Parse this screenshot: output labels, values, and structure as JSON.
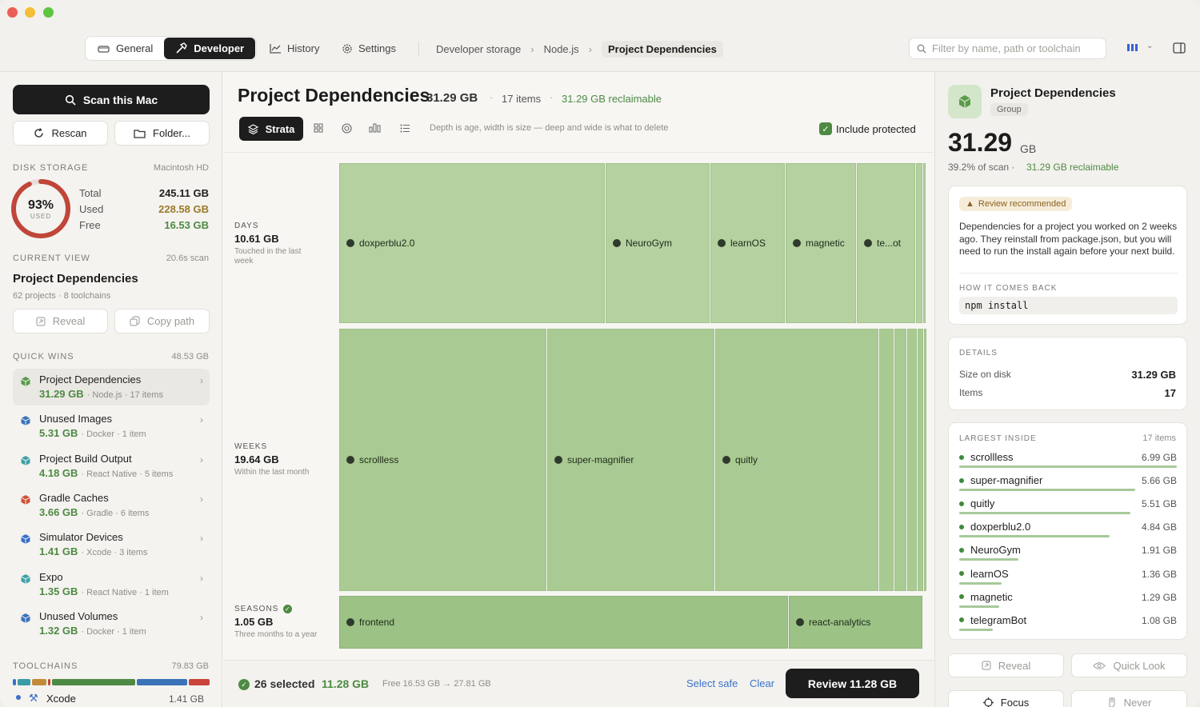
{
  "titlebar": {
    "segments": [
      {
        "label": "General"
      },
      {
        "label": "Developer"
      }
    ],
    "nav": [
      {
        "label": "History"
      },
      {
        "label": "Settings"
      }
    ],
    "breadcrumb": [
      "Developer storage",
      "Node.js",
      "Project Dependencies"
    ],
    "search_placeholder": "Filter by name, path or toolchain"
  },
  "sidebar": {
    "scan_label": "Scan this Mac",
    "rescan_label": "Rescan",
    "folder_label": "Folder...",
    "disk": {
      "section": "DISK STORAGE",
      "volume": "Macintosh HD",
      "percent": "93%",
      "percent_value": 93,
      "used_caption": "USED",
      "rows": [
        {
          "label": "Total",
          "value": "245.11 GB"
        },
        {
          "label": "Used",
          "value": "228.58 GB"
        },
        {
          "label": "Free",
          "value": "16.53 GB"
        }
      ]
    },
    "current_view": {
      "section": "CURRENT VIEW",
      "scan_time": "20.6s scan",
      "title": "Project Dependencies",
      "sub": "62 projects · 8 toolchains",
      "reveal": "Reveal",
      "copy_path": "Copy path"
    },
    "quick_wins": {
      "section": "QUICK WINS",
      "total": "48.53 GB",
      "items": [
        {
          "title": "Project Dependencies",
          "size": "31.29 GB",
          "meta": "· Node.js · 17 items",
          "icon": "cube-green-icon",
          "color": "#5a9a4c"
        },
        {
          "title": "Unused Images",
          "size": "5.31 GB",
          "meta": "· Docker · 1 item",
          "icon": "cube-blue-icon",
          "color": "#3b73b9"
        },
        {
          "title": "Project Build Output",
          "size": "4.18 GB",
          "meta": "· React Native · 5 items",
          "icon": "atom-icon",
          "color": "#3fa0a8"
        },
        {
          "title": "Gradle Caches",
          "size": "3.66 GB",
          "meta": "· Gradle · 6 items",
          "icon": "gears-icon",
          "color": "#d0533b"
        },
        {
          "title": "Simulator Devices",
          "size": "1.41 GB",
          "meta": "· Xcode · 3 items",
          "icon": "hammer-icon",
          "color": "#3b6fc9"
        },
        {
          "title": "Expo",
          "size": "1.35 GB",
          "meta": "· React Native · 1 item",
          "icon": "atom-icon",
          "color": "#3fa0a8"
        },
        {
          "title": "Unused Volumes",
          "size": "1.32 GB",
          "meta": "· Docker · 1 item",
          "icon": "cube-blue-icon",
          "color": "#3b73b9"
        }
      ]
    },
    "toolchains": {
      "section": "TOOLCHAINS",
      "total": "79.83 GB",
      "first": {
        "name": "Xcode",
        "size": "1.41 GB"
      }
    }
  },
  "main": {
    "title": "Project Dependencies",
    "size": "31.29 GB",
    "items": "17 items",
    "reclaimable": "31.29 GB reclaimable",
    "view_label": "Strata",
    "hint": "Depth is age, width is size — deep and wide is what to delete",
    "include_protected": "Include protected",
    "bands": [
      {
        "name": "DAYS",
        "size": "10.61 GB",
        "desc": "Touched in the last week"
      },
      {
        "name": "WEEKS",
        "size": "19.64 GB",
        "desc": "Within the last month"
      },
      {
        "name": "SEASONS",
        "size": "1.05 GB",
        "desc": "Three months to a year"
      }
    ],
    "tiles": {
      "days": [
        "doxperblu2.0",
        "NeuroGym",
        "learnOS",
        "magnetic",
        "te...ot"
      ],
      "weeks": [
        "scrollless",
        "super-magnifier",
        "quitly"
      ],
      "seasons": [
        "frontend",
        "react-analytics"
      ]
    },
    "footer": {
      "selected": "26 selected",
      "selected_size": "11.28 GB",
      "free_change": "Free 16.53 GB → 27.81 GB",
      "select_safe": "Select safe",
      "clear": "Clear",
      "review": "Review 11.28 GB"
    }
  },
  "inspector": {
    "title": "Project Dependencies",
    "badge": "Group",
    "size_number": "31.29",
    "size_unit": "GB",
    "scan_share": "39.2% of scan ·",
    "reclaimable": "31.29 GB reclaimable",
    "review_badge": "Review recommended",
    "description": "Dependencies for a project you worked on 2 weeks ago. They reinstall from package.json, but you will need to run the install again before your next build.",
    "comes_back_label": "HOW IT COMES BACK",
    "command": "npm install",
    "details_label": "DETAILS",
    "details": [
      {
        "label": "Size on disk",
        "value": "31.29 GB"
      },
      {
        "label": "Items",
        "value": "17"
      }
    ],
    "largest_label": "LARGEST INSIDE",
    "largest_count": "17 items",
    "largest": [
      {
        "name": "scrollless",
        "size": "6.99 GB",
        "value": 6.99
      },
      {
        "name": "super-magnifier",
        "size": "5.66 GB",
        "value": 5.66
      },
      {
        "name": "quitly",
        "size": "5.51 GB",
        "value": 5.51
      },
      {
        "name": "doxperblu2.0",
        "size": "4.84 GB",
        "value": 4.84
      },
      {
        "name": "NeuroGym",
        "size": "1.91 GB",
        "value": 1.91
      },
      {
        "name": "learnOS",
        "size": "1.36 GB",
        "value": 1.36
      },
      {
        "name": "magnetic",
        "size": "1.29 GB",
        "value": 1.29
      },
      {
        "name": "telegramBot",
        "size": "1.08 GB",
        "value": 1.08
      }
    ],
    "reveal": "Reveal",
    "quick_look": "Quick Look",
    "focus": "Focus",
    "never": "Never"
  }
}
